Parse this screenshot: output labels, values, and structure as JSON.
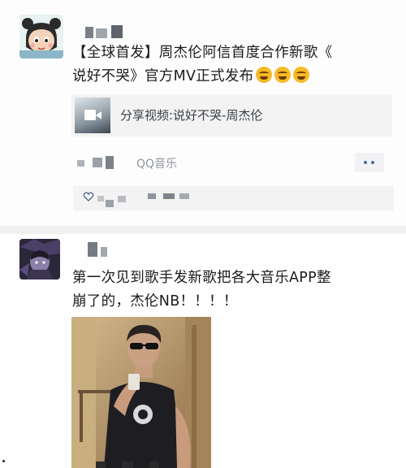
{
  "posts": [
    {
      "text_line1": "【全球首发】周杰伦阿信首度合作新歌《",
      "text_line2": "说好不哭》官方MV正式发布",
      "emojis": [
        "crying-laugh",
        "crying-laugh",
        "crying-laugh"
      ],
      "share": {
        "title": "分享视频:说好不哭-周杰伦",
        "thumb_icon": "video-camera-icon"
      },
      "source": "QQ音乐",
      "more_icon": "more-dots-icon",
      "like_icon": "heart-outline-icon"
    },
    {
      "text_line1": "第一次见到歌手发新歌把各大音乐APP整",
      "text_line2": "崩了的，杰伦NB！！！！"
    }
  ],
  "colors": {
    "link": "#576b95",
    "background": "#ffffff",
    "card": "#f3f3f3"
  }
}
